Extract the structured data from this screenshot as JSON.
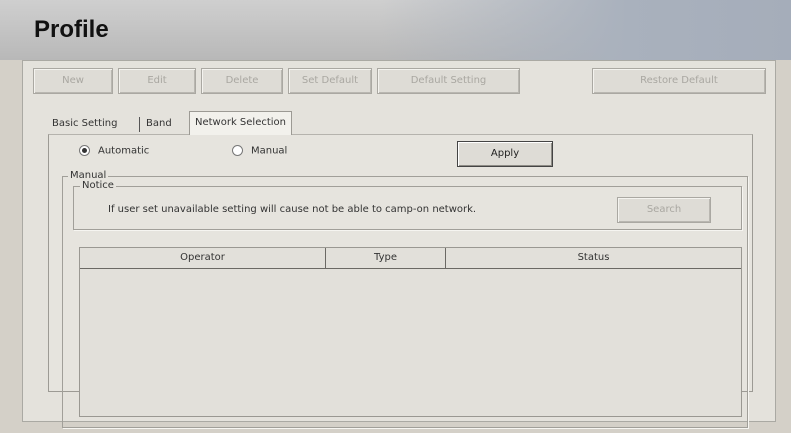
{
  "header": {
    "title": "Profile"
  },
  "toolbar": {
    "buttons": [
      {
        "label": "New"
      },
      {
        "label": "Edit"
      },
      {
        "label": "Delete"
      },
      {
        "label": "Set Default"
      },
      {
        "label": "Default Setting"
      },
      {
        "label": "Restore Default"
      }
    ]
  },
  "tabs": [
    {
      "label": "Basic Setting"
    },
    {
      "label": "Band"
    },
    {
      "label": "Network Selection",
      "active": true
    }
  ],
  "network_selection": {
    "mode_options": [
      {
        "label": "Automatic",
        "checked": true
      },
      {
        "label": "Manual",
        "checked": false
      }
    ],
    "apply_label": "Apply",
    "manual_group_label": "Manual",
    "notice_group_label": "Notice",
    "notice_text": "If user set unavailable setting will cause  not be able to camp-on network.",
    "search_label": "Search",
    "table": {
      "columns": [
        "Operator",
        "Type",
        "Status"
      ],
      "rows": []
    }
  }
}
